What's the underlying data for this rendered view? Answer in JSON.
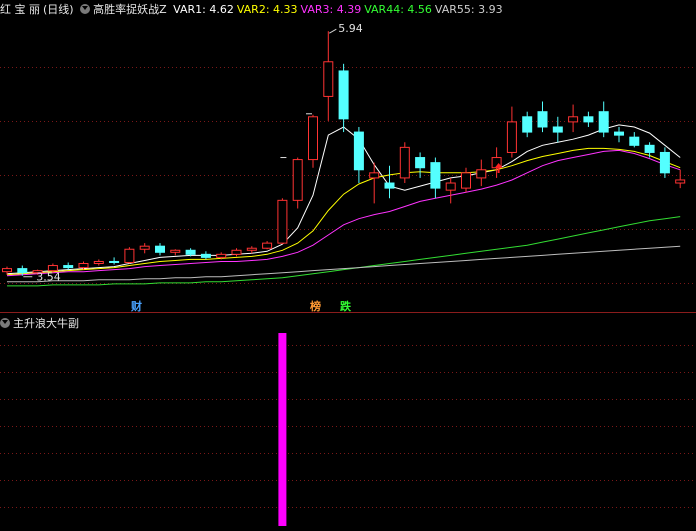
{
  "header_top": {
    "stock_name": "红 宝 丽",
    "period": "(日线)",
    "indicator": "高胜率捉妖战Z",
    "values": [
      {
        "label": "VAR1:",
        "value": "4.62",
        "color": "#ffffff"
      },
      {
        "label": "VAR2:",
        "value": "4.33",
        "color": "#ffff00"
      },
      {
        "label": "VAR3:",
        "value": "4.39",
        "color": "#ff33ff"
      },
      {
        "label": "VAR44:",
        "value": "4.56",
        "color": "#33ff33"
      },
      {
        "label": "VAR55:",
        "value": "3.93",
        "color": "#cfcfcf"
      }
    ]
  },
  "header_bottom": {
    "indicator": "主升浪大牛副"
  },
  "annotations": {
    "high_label": "5.94",
    "low_label": "3.54",
    "marker_cai": "财",
    "marker_bang": "榜",
    "marker_die": "跌"
  },
  "colors": {
    "up": "#ff3333",
    "down": "#54ffff",
    "var1": "#ffffff",
    "var2": "#ffff00",
    "var3": "#ff33ff",
    "var44": "#33dd33",
    "var55": "#bdbdbd",
    "grid": "#7a1818",
    "hist": "#ff00ff",
    "cai": "#4aa3ff",
    "bang": "#ff9933",
    "die": "#33ff33"
  },
  "chart_data": [
    {
      "type": "candlestick",
      "candles": [
        [
          3.58,
          3.63,
          3.55,
          3.61
        ],
        [
          3.61,
          3.64,
          3.54,
          3.57
        ],
        [
          3.57,
          3.6,
          3.55,
          3.59
        ],
        [
          3.59,
          3.66,
          3.57,
          3.64
        ],
        [
          3.64,
          3.67,
          3.6,
          3.62
        ],
        [
          3.62,
          3.68,
          3.6,
          3.66
        ],
        [
          3.66,
          3.7,
          3.64,
          3.68
        ],
        [
          3.68,
          3.72,
          3.65,
          3.67
        ],
        [
          3.67,
          3.82,
          3.66,
          3.8
        ],
        [
          3.8,
          3.86,
          3.76,
          3.83
        ],
        [
          3.83,
          3.86,
          3.74,
          3.77
        ],
        [
          3.77,
          3.8,
          3.74,
          3.79
        ],
        [
          3.79,
          3.81,
          3.73,
          3.75
        ],
        [
          3.75,
          3.78,
          3.7,
          3.72
        ],
        [
          3.72,
          3.77,
          3.7,
          3.75
        ],
        [
          3.75,
          3.81,
          3.73,
          3.79
        ],
        [
          3.79,
          3.83,
          3.76,
          3.81
        ],
        [
          3.81,
          3.88,
          3.8,
          3.86
        ],
        [
          3.86,
          4.3,
          3.85,
          4.28
        ],
        [
          4.28,
          4.7,
          4.2,
          4.68
        ],
        [
          4.68,
          5.12,
          4.6,
          5.1
        ],
        [
          5.3,
          5.94,
          5.06,
          5.64
        ],
        [
          5.55,
          5.62,
          4.95,
          5.08
        ],
        [
          4.95,
          5.0,
          4.45,
          4.58
        ],
        [
          4.5,
          4.65,
          4.25,
          4.55
        ],
        [
          4.45,
          4.62,
          4.3,
          4.4
        ],
        [
          4.5,
          4.85,
          4.45,
          4.8
        ],
        [
          4.7,
          4.75,
          4.5,
          4.6
        ],
        [
          4.65,
          4.7,
          4.3,
          4.4
        ],
        [
          4.38,
          4.5,
          4.25,
          4.45
        ],
        [
          4.4,
          4.6,
          4.36,
          4.55
        ],
        [
          4.5,
          4.68,
          4.42,
          4.58
        ],
        [
          4.6,
          4.8,
          4.5,
          4.7
        ],
        [
          4.75,
          5.2,
          4.7,
          5.05
        ],
        [
          5.1,
          5.15,
          4.9,
          4.95
        ],
        [
          5.15,
          5.25,
          4.95,
          5.0
        ],
        [
          5.0,
          5.1,
          4.85,
          4.95
        ],
        [
          5.05,
          5.22,
          4.95,
          5.1
        ],
        [
          5.1,
          5.15,
          5.0,
          5.05
        ],
        [
          5.15,
          5.25,
          4.9,
          4.95
        ],
        [
          4.95,
          5.0,
          4.85,
          4.92
        ],
        [
          4.9,
          4.95,
          4.8,
          4.82
        ],
        [
          4.82,
          4.85,
          4.7,
          4.75
        ],
        [
          4.75,
          4.8,
          4.5,
          4.55
        ],
        [
          4.45,
          4.58,
          4.4,
          4.48
        ]
      ],
      "high_point": 5.94,
      "low_point": 3.54,
      "ylim": [
        3.4,
        6.05
      ]
    },
    {
      "type": "line",
      "series": [
        {
          "name": "VAR1",
          "values": [
            3.56,
            3.57,
            3.58,
            3.59,
            3.6,
            3.61,
            3.62,
            3.63,
            3.66,
            3.69,
            3.72,
            3.73,
            3.74,
            3.74,
            3.74,
            3.75,
            3.76,
            3.78,
            3.85,
            4.01,
            4.33,
            4.92,
            5.0,
            4.88,
            4.63,
            4.42,
            4.38,
            4.42,
            4.46,
            4.5,
            4.52,
            4.55,
            4.58,
            4.66,
            4.76,
            4.82,
            4.85,
            4.88,
            4.92,
            4.98,
            5.02,
            5.0,
            4.94,
            4.82,
            4.7
          ]
        },
        {
          "name": "VAR2",
          "values": [
            3.55,
            3.56,
            3.57,
            3.58,
            3.59,
            3.6,
            3.61,
            3.62,
            3.64,
            3.66,
            3.68,
            3.69,
            3.7,
            3.7,
            3.71,
            3.72,
            3.73,
            3.75,
            3.79,
            3.86,
            3.98,
            4.18,
            4.34,
            4.44,
            4.5,
            4.53,
            4.55,
            4.56,
            4.55,
            4.55,
            4.55,
            4.56,
            4.58,
            4.62,
            4.67,
            4.71,
            4.74,
            4.77,
            4.79,
            4.79,
            4.78,
            4.76,
            4.72,
            4.66,
            4.6
          ]
        },
        {
          "name": "VAR3",
          "values": [
            3.54,
            3.55,
            3.56,
            3.57,
            3.58,
            3.58,
            3.59,
            3.6,
            3.61,
            3.63,
            3.64,
            3.65,
            3.66,
            3.67,
            3.68,
            3.68,
            3.69,
            3.7,
            3.73,
            3.77,
            3.84,
            3.94,
            4.04,
            4.1,
            4.14,
            4.17,
            4.22,
            4.27,
            4.3,
            4.33,
            4.36,
            4.39,
            4.43,
            4.48,
            4.55,
            4.62,
            4.67,
            4.7,
            4.73,
            4.76,
            4.77,
            4.74,
            4.69,
            4.63,
            4.58
          ]
        },
        {
          "name": "VAR44",
          "values": [
            3.44,
            3.44,
            3.44,
            3.45,
            3.45,
            3.45,
            3.45,
            3.46,
            3.46,
            3.46,
            3.47,
            3.47,
            3.47,
            3.48,
            3.48,
            3.49,
            3.5,
            3.51,
            3.52,
            3.54,
            3.56,
            3.58,
            3.6,
            3.62,
            3.64,
            3.66,
            3.68,
            3.7,
            3.72,
            3.74,
            3.76,
            3.78,
            3.8,
            3.82,
            3.84,
            3.87,
            3.9,
            3.93,
            3.96,
            3.99,
            4.02,
            4.05,
            4.08,
            4.1,
            4.12
          ]
        },
        {
          "name": "VAR55",
          "values": [
            3.48,
            3.48,
            3.48,
            3.49,
            3.49,
            3.49,
            3.5,
            3.5,
            3.5,
            3.51,
            3.51,
            3.52,
            3.52,
            3.53,
            3.53,
            3.54,
            3.55,
            3.56,
            3.57,
            3.58,
            3.59,
            3.6,
            3.61,
            3.62,
            3.63,
            3.64,
            3.65,
            3.66,
            3.67,
            3.68,
            3.69,
            3.7,
            3.71,
            3.72,
            3.73,
            3.74,
            3.75,
            3.76,
            3.77,
            3.78,
            3.79,
            3.8,
            3.81,
            3.82,
            3.83
          ]
        }
      ]
    },
    {
      "type": "bar",
      "series": [
        {
          "values": [
            0,
            0,
            0,
            0,
            0,
            0,
            0,
            0,
            0,
            0,
            0,
            0,
            0,
            0,
            0,
            0,
            0,
            0,
            1,
            0,
            0,
            0,
            0,
            0,
            0,
            0,
            0,
            0,
            0,
            0,
            0,
            0,
            0,
            0,
            0,
            0,
            0,
            0,
            0,
            0,
            0,
            0,
            0,
            0,
            0
          ]
        }
      ],
      "ylim": [
        0,
        1
      ]
    }
  ]
}
